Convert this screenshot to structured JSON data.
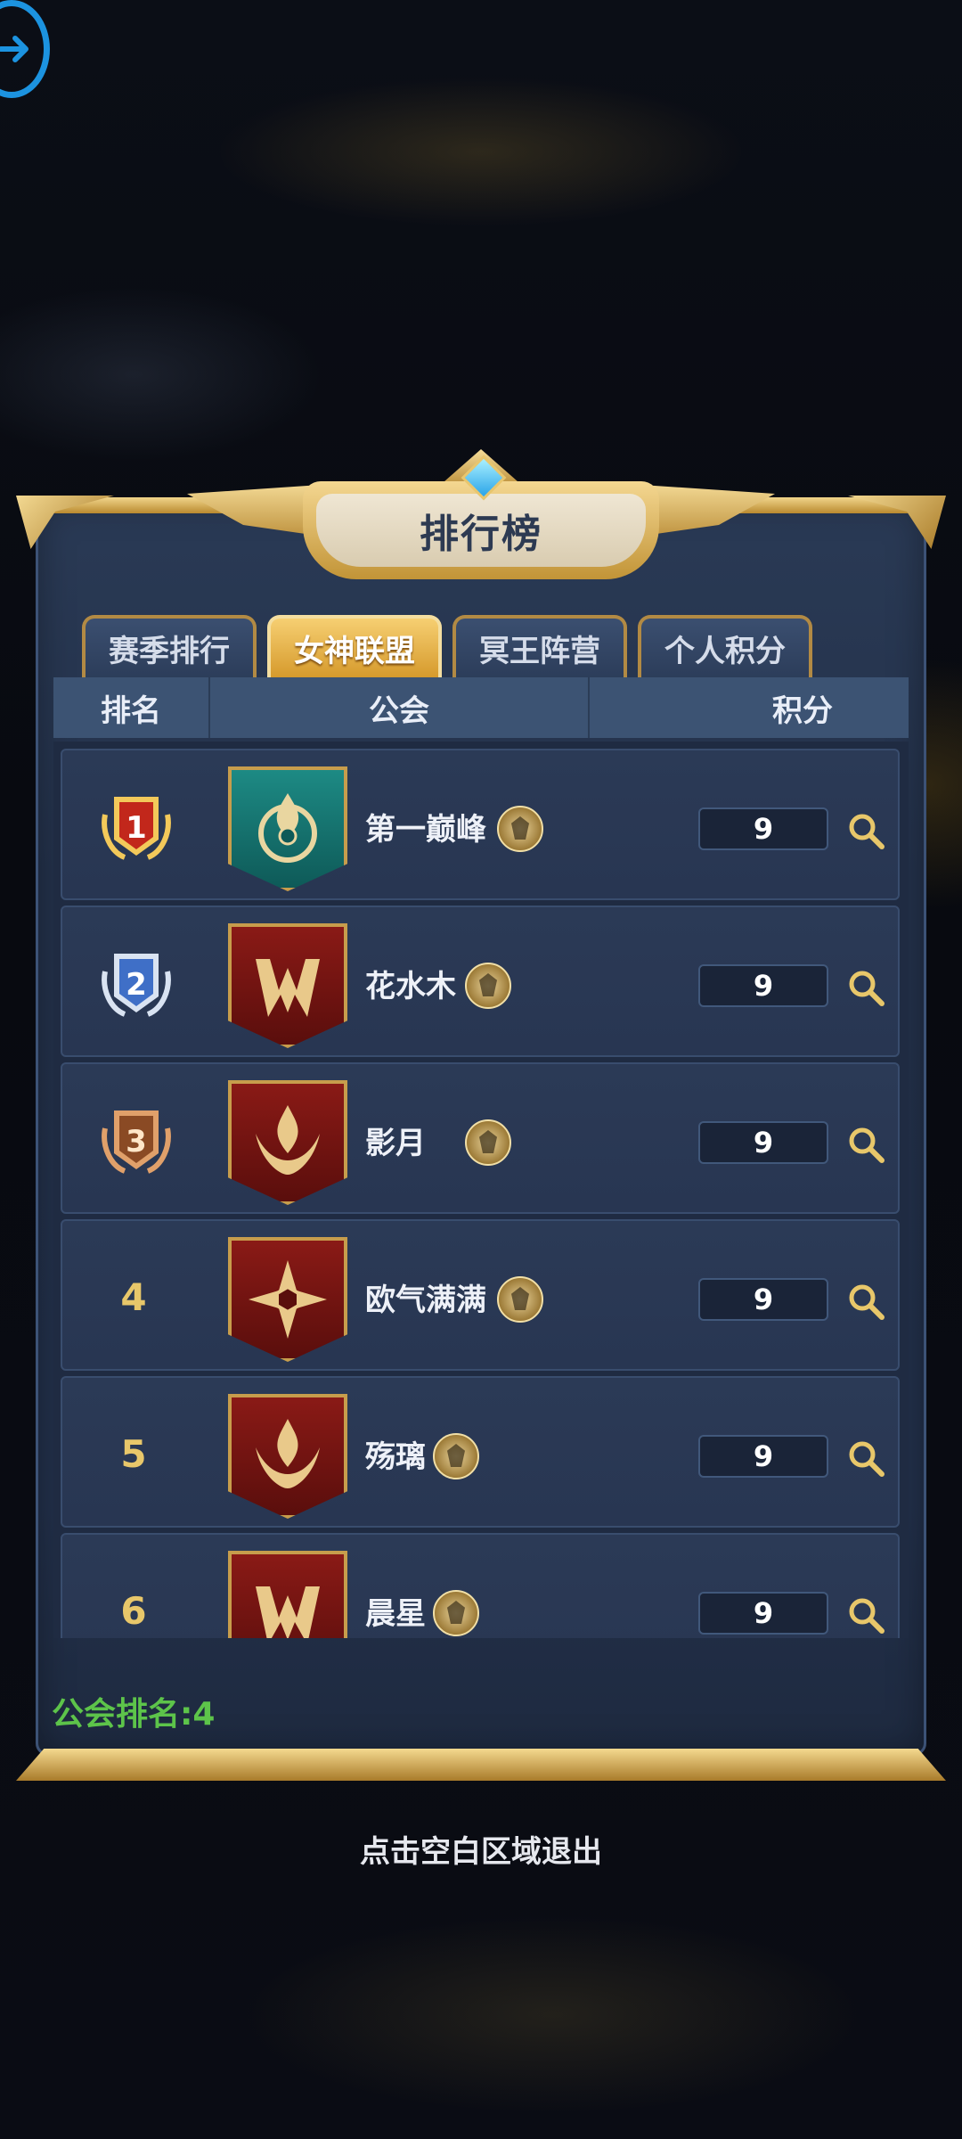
{
  "panel": {
    "title": "排行榜"
  },
  "tabs": [
    {
      "label": "赛季排行",
      "active": false
    },
    {
      "label": "女神联盟",
      "active": true
    },
    {
      "label": "冥王阵营",
      "active": false
    },
    {
      "label": "个人积分",
      "active": false
    }
  ],
  "table": {
    "headers": {
      "rank": "排名",
      "guild": "公会",
      "score": "积分"
    },
    "rows": [
      {
        "rank": "1",
        "medal": "gold",
        "emblem": "teal-flame",
        "name": "第一巅峰",
        "score": "9"
      },
      {
        "rank": "2",
        "medal": "silver",
        "emblem": "red-crown",
        "name": "花水木",
        "score": "9"
      },
      {
        "rank": "3",
        "medal": "bronze",
        "emblem": "red-flame",
        "name": "影月",
        "score": "9"
      },
      {
        "rank": "4",
        "medal": "",
        "emblem": "red-compass",
        "name": "欧气满满",
        "score": "9"
      },
      {
        "rank": "5",
        "medal": "",
        "emblem": "red-flame",
        "name": "殇璃",
        "score": "9"
      },
      {
        "rank": "6",
        "medal": "",
        "emblem": "red-crown",
        "name": "晨星",
        "score": "9"
      }
    ]
  },
  "footer": {
    "guild_rank": "公会排名:4"
  },
  "exit_hint": "点击空白区域退出",
  "colors": {
    "gold": "#e8c76a",
    "accent_tab": "#e0a83a",
    "guild_rank_green": "#5dc44a",
    "back_blue": "#1c93e0"
  }
}
